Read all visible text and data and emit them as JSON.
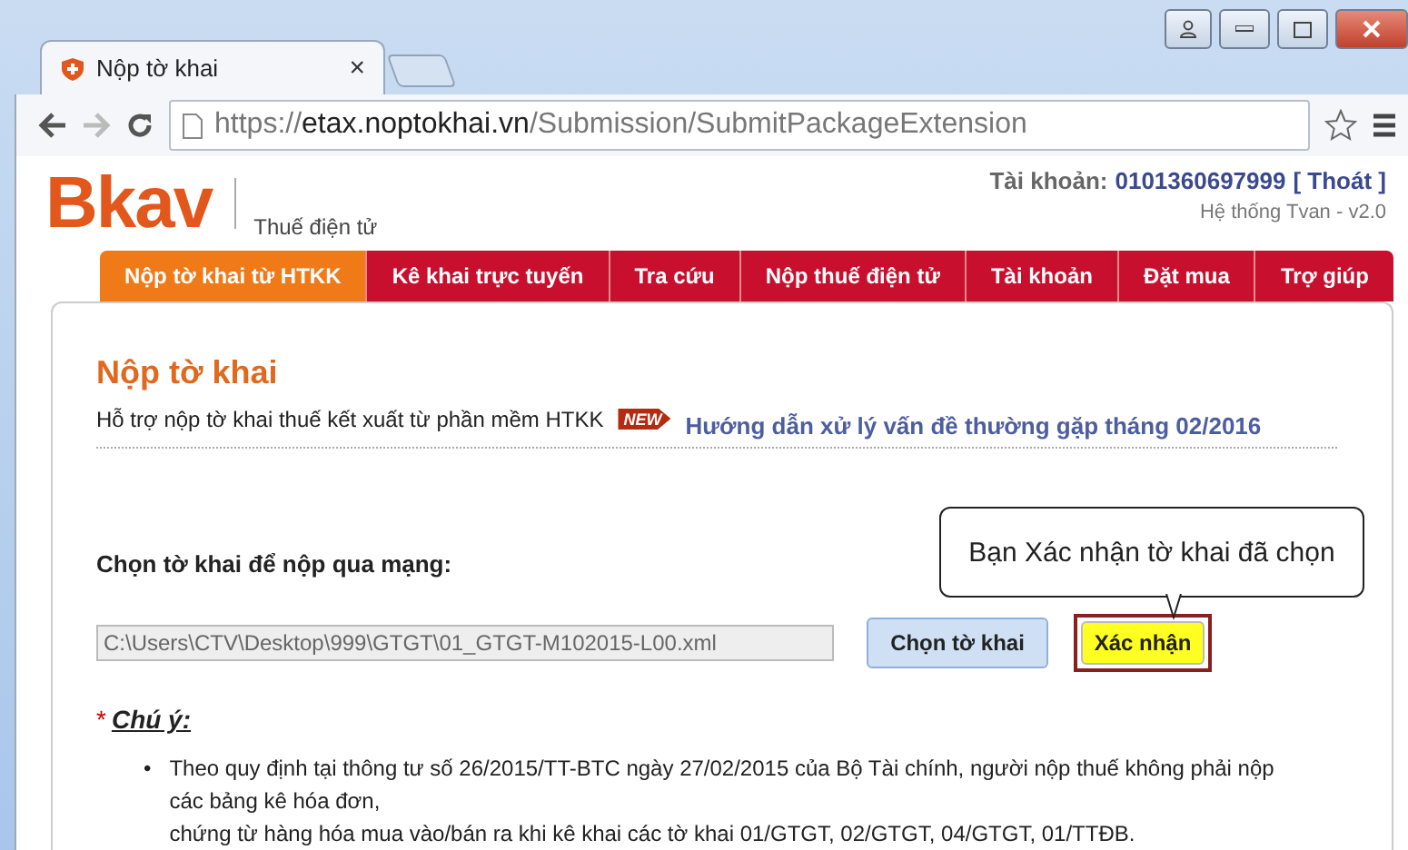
{
  "browser": {
    "tab_title": "Nộp tờ khai",
    "tab_close": "×",
    "url_scheme": "https://",
    "url_host": "etax.noptokhai.vn",
    "url_path": "/Submission/SubmitPackageExtension"
  },
  "header": {
    "logo": "Bkav",
    "subtitle": "Thuế điện tử",
    "account_label": "Tài khoản:",
    "account_number": "0101360697999",
    "logout": "[ Thoát ]",
    "system": "Hệ thống Tvan - v2.0"
  },
  "nav": [
    {
      "label": "Nộp tờ khai từ HTKK",
      "selected": true
    },
    {
      "label": "Kê khai trực tuyến",
      "selected": false
    },
    {
      "label": "Tra cứu",
      "selected": false
    },
    {
      "label": "Nộp thuế điện tử",
      "selected": false
    },
    {
      "label": "Tài khoản",
      "selected": false
    },
    {
      "label": "Đặt mua",
      "selected": false
    },
    {
      "label": "Trợ giúp",
      "selected": false
    }
  ],
  "page": {
    "title": "Nộp tờ khai",
    "subtitle": "Hỗ trợ nộp tờ khai thuế kết xuất từ phần mềm HTKK",
    "new_badge": "NEW",
    "guide_link": "Hướng dẫn xử lý vấn đề thường gặp tháng 02/2016"
  },
  "form": {
    "label": "Chọn tờ khai để nộp qua mạng:",
    "file_path": "C:\\Users\\CTV\\Desktop\\999\\GTGT\\01_GTGT-M102015-L00.xml",
    "choose_button": "Chọn tờ khai",
    "confirm_button": "Xác nhận",
    "callout": "Bạn Xác nhận tờ khai đã chọn"
  },
  "note": {
    "asterisk": "*",
    "title": "Chú ý:",
    "bullet": "•",
    "lines": [
      "Theo quy định tại thông tư số 26/2015/TT-BTC ngày 27/02/2015 của Bộ Tài chính, người nộp thuế không phải nộp các bảng kê hóa đơn,",
      "chứng từ hàng hóa mua vào/bán ra khi kê khai các tờ khai 01/GTGT, 02/GTGT, 04/GTGT, 01/TTĐB."
    ]
  }
}
